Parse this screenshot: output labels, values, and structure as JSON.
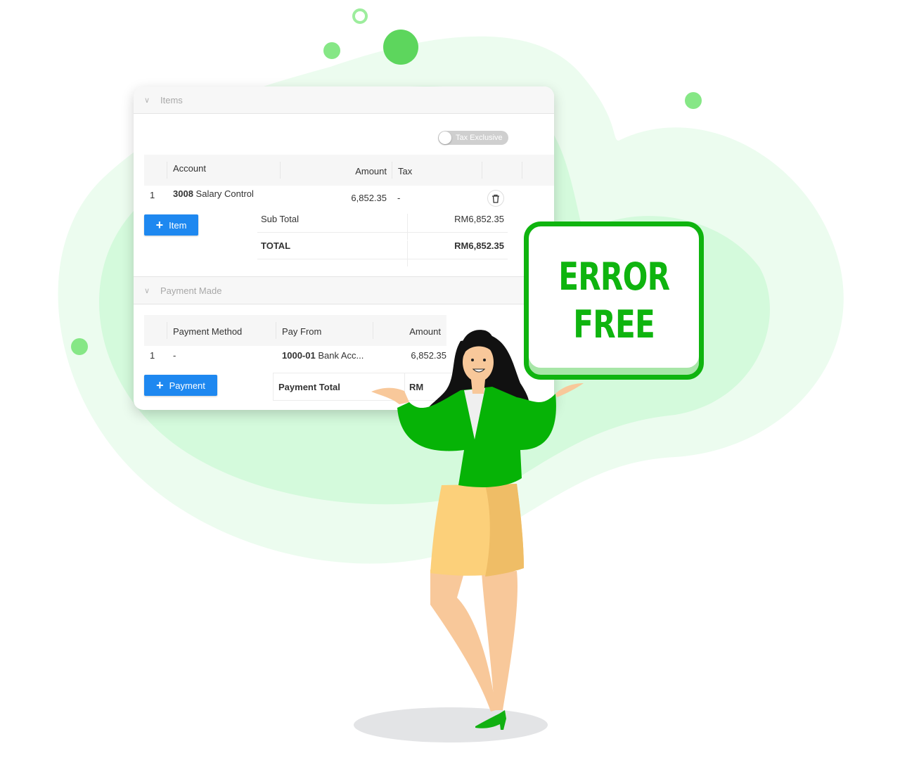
{
  "items_section": {
    "title": "Items",
    "tax_toggle_label": "Tax Exclusive",
    "tax_toggle_on": false,
    "columns": [
      "Account",
      "Amount",
      "Tax"
    ],
    "rows": [
      {
        "index": "1",
        "account_code": "3008",
        "account_name": "Salary Control",
        "amount": "6,852.35",
        "tax": "-"
      }
    ],
    "add_item_label": "Item",
    "subtotal_label": "Sub Total",
    "subtotal_value": "RM6,852.35",
    "total_label": "TOTAL",
    "total_value": "RM6,852.35"
  },
  "payment_section": {
    "title": "Payment Made",
    "columns": [
      "Payment Method",
      "Pay From",
      "Amount"
    ],
    "rows": [
      {
        "index": "1",
        "method": "-",
        "pay_from_code": "1000-01",
        "pay_from_name": "Bank Acc...",
        "amount": "6,852.35"
      }
    ],
    "add_payment_label": "Payment",
    "payment_total_label": "Payment Total",
    "payment_total_value": "RM"
  },
  "sign": {
    "line1": "ERROR",
    "line2": "FREE"
  },
  "colors": {
    "brand_green": "#0fb40f",
    "button_blue": "#1e88f0",
    "blob_light": "#ecfcef",
    "blob_mid": "#d4fadc"
  }
}
